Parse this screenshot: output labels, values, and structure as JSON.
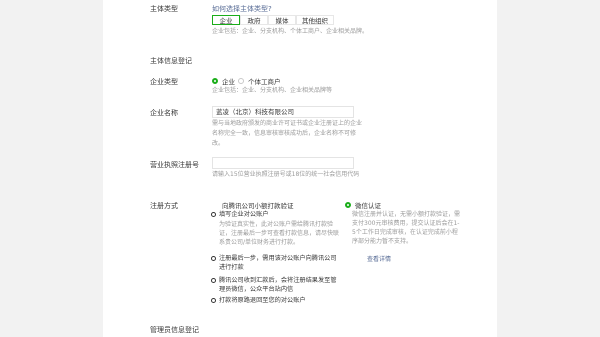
{
  "entity_type": {
    "label": "主体类型",
    "help_link": "如何选择主体类型?",
    "tabs": [
      "企业",
      "政府",
      "媒体",
      "其他组织"
    ],
    "hint": "企业包括：企业、分支机构、个体工商户、企业相关品牌。"
  },
  "section_info": {
    "title": "主体信息登记"
  },
  "enterprise_type": {
    "label": "企业类型",
    "options": [
      "企业",
      "个体工商户"
    ],
    "selected": "企业",
    "hint": "企业包括：企业、分支机构、企业相关品牌等"
  },
  "enterprise_name": {
    "label": "企业名称",
    "value": "蓝凌（北京）科技有限公司",
    "hint": "需与当地政府颁发的商业许可证书或企业注册证上的企业名称完全一致，信息审核审核成功后，企业名称不可修改。"
  },
  "license_no": {
    "label": "营业执照注册号",
    "value": "",
    "hint": "请输入15位营业执照注册号或18位的统一社会信用代码"
  },
  "register_method": {
    "label": "注册方式",
    "option_left": "向腾讯公司小额打款验证",
    "option_right": "微信认证",
    "left_steps": [
      "填写企业对公账户",
      "注册最后一步，需用该对公账户向腾讯公司进行打款",
      "腾讯公司收到汇款后，会将注册结果发至管理员微信，公众平台站内信",
      "打款将原路退回至您的对公账户"
    ],
    "left_step1_hint": "为验证真实性，此对公账户需给腾讯打款验证，注册最后一步可查看打款信息，请尽快联系贵公司/单位财务进行打款。",
    "right_hint": "微信注册并认证，无需小额打款验证，需支付300元审核费用，提交认证后会在1-5个工作日完成审核，在认证完成前小程序部分能力暂不支持。",
    "right_link": "查看详情"
  },
  "section_admin": {
    "title": "管理员信息登记"
  },
  "colors": {
    "accent": "#1aad19",
    "link": "#576b95",
    "hint": "#9a9a9a",
    "gutter": "#f2f2f2"
  }
}
